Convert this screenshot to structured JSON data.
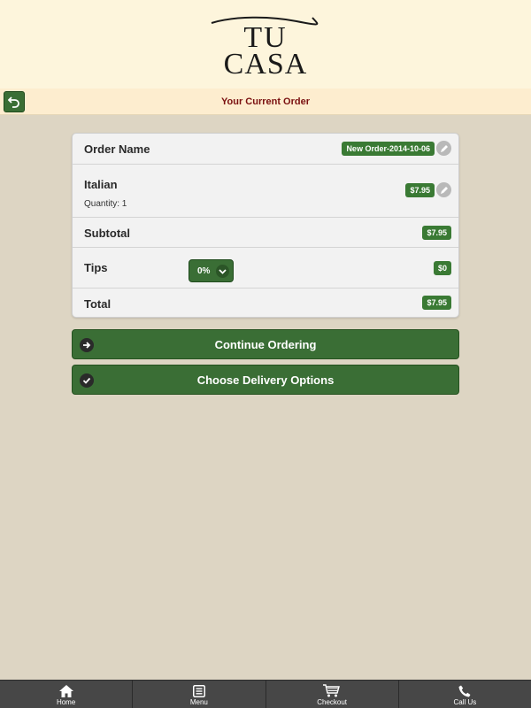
{
  "brand": {
    "line1": "TU",
    "line2": "CASA"
  },
  "header": {
    "title": "Your Current Order"
  },
  "order": {
    "name_label": "Order Name",
    "name_value": "New Order-2014-10-06",
    "item_name": "Italian",
    "item_quantity": "Quantity: 1",
    "item_price": "$7.95",
    "subtotal_label": "Subtotal",
    "subtotal_value": "$7.95",
    "tips_label": "Tips",
    "tips_selected": "0%",
    "tips_value": "$0",
    "total_label": "Total",
    "total_value": "$7.95"
  },
  "actions": {
    "continue_label": "Continue Ordering",
    "delivery_label": "Choose Delivery Options"
  },
  "nav": {
    "home": "Home",
    "menu": "Menu",
    "checkout": "Checkout",
    "call": "Call Us"
  },
  "colors": {
    "accent_green": "#3a6e35",
    "header_text": "#7a1010",
    "background": "#ddd5c3"
  }
}
